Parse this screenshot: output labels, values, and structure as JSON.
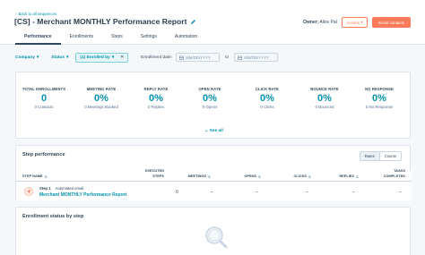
{
  "header": {
    "back_link": "Back to all sequences",
    "title": "[CS] - Merchant MONTHLY Performance Report",
    "owner_label": "Owner:",
    "owner_name": "Alice Pai",
    "actions_label": "Actions",
    "enroll_label": "Enroll contacts"
  },
  "tabs": [
    {
      "label": "Performance",
      "active": true
    },
    {
      "label": "Enrollments",
      "active": false
    },
    {
      "label": "Steps",
      "active": false
    },
    {
      "label": "Settings",
      "active": false
    },
    {
      "label": "Automation",
      "active": false
    }
  ],
  "filters": {
    "company": "Company",
    "status": "Status",
    "enrolled_by": "(1) Enrolled by",
    "enrollment_date_label": "Enrollment date:",
    "date_placeholder_from": "MM/DD/YYYY",
    "to_label": "to",
    "date_placeholder_to": "MM/DD/YYYY"
  },
  "stats": [
    {
      "label": "TOTAL ENROLLMENTS",
      "value": "0",
      "sub": "0 Contacts"
    },
    {
      "label": "MEETING RATE",
      "value": "0%",
      "sub": "0 Meetings Booked"
    },
    {
      "label": "REPLY RATE",
      "value": "0%",
      "sub": "0 Replies"
    },
    {
      "label": "OPEN RATE",
      "value": "0%",
      "sub": "0 Opens"
    },
    {
      "label": "CLICK RATE",
      "value": "0%",
      "sub": "0 Clicks"
    },
    {
      "label": "BOUNCE RATE",
      "value": "0%",
      "sub": "0 Bounced"
    },
    {
      "label": "NO RESPONSE",
      "value": "0%",
      "sub": "0 No Response"
    }
  ],
  "see_all": "See all",
  "step_performance": {
    "title": "Step performance",
    "toggle": [
      "Rates",
      "Counts"
    ],
    "columns": {
      "step_name": "STEP NAME",
      "executed_1": "EXECUTED",
      "executed_2": "STEPS",
      "meetings": "MEETINGS",
      "opens": "OPENS",
      "clicks": "CLICKS",
      "replies": "REPLIES",
      "tasks_1": "TASKS",
      "tasks_2": "COMPLETED"
    },
    "rows": [
      {
        "step": "Step 1",
        "type": "Automated email",
        "name": "Merchant MONTHLY Performance Report",
        "executed": "0",
        "meetings": "–",
        "opens": "–",
        "clicks": "–",
        "replies": "–",
        "tasks": "–"
      }
    ]
  },
  "enrollment_status": {
    "title": "Enrollment status by step"
  },
  "colors": {
    "accent": "#ff7a59",
    "link": "#0091ae",
    "text": "#33475b",
    "background": "#f5f8fa"
  }
}
